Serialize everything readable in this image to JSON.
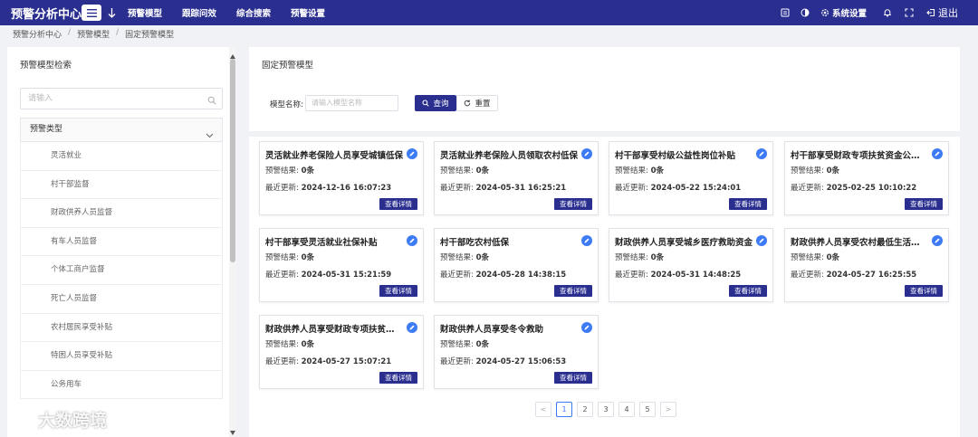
{
  "header": {
    "brand": "预警分析中心",
    "nav": [
      "预警模型",
      "跟踪问效",
      "综合搜索",
      "预警设置"
    ],
    "right": {
      "settings_label": "系统设置",
      "logout_label": "退出"
    }
  },
  "breadcrumb": [
    "预警分析中心",
    "预警模型",
    "固定预警模型"
  ],
  "left_panel": {
    "title": "预警模型检索",
    "search_placeholder": "请输入",
    "type_header": "预警类型",
    "types": [
      "灵活就业",
      "村干部监督",
      "财政供养人员监督",
      "有车人员监督",
      "个体工商户监督",
      "死亡人员监督",
      "农村居民享受补贴",
      "特困人员享受补贴",
      "公务用车"
    ]
  },
  "right_panel": {
    "title": "固定预警模型",
    "filter_label": "模型名称:",
    "filter_placeholder": "请输入模型名称",
    "query_label": "查询",
    "reset_label": "重置",
    "result_label": "预警结果:",
    "update_label": "最近更新:",
    "detail_label": "查看详情",
    "cards": [
      {
        "title": "灵活就业养老保险人员享受城镇低保",
        "result": "0条",
        "updated": "2024-12-16 16:07:23"
      },
      {
        "title": "灵活就业养老保险人员领取农村低保",
        "result": "0条",
        "updated": "2024-05-31 16:25:21"
      },
      {
        "title": "村干部享受村级公益性岗位补贴",
        "result": "0条",
        "updated": "2024-05-22 15:24:01"
      },
      {
        "title": "村干部享受财政专项扶贫资金公益性…",
        "result": "0条",
        "updated": "2025-02-25 10:10:22"
      },
      {
        "title": "村干部享受灵活就业社保补贴",
        "result": "0条",
        "updated": "2024-05-31 15:21:59"
      },
      {
        "title": "村干部吃农村低保",
        "result": "0条",
        "updated": "2024-05-28 14:38:15"
      },
      {
        "title": "财政供养人员享受城乡医疗救助资金",
        "result": "0条",
        "updated": "2024-05-31 14:48:25"
      },
      {
        "title": "财政供养人员享受农村最低生活保障…",
        "result": "0条",
        "updated": "2024-05-27 16:25:55"
      },
      {
        "title": "财政供养人员享受财政专项扶贫资金…",
        "result": "0条",
        "updated": "2024-05-27 15:07:21"
      },
      {
        "title": "财政供养人员享受冬令救助",
        "result": "0条",
        "updated": "2024-05-27 15:06:53"
      }
    ]
  },
  "pagination": {
    "prev": "<",
    "pages": [
      "1",
      "2",
      "3",
      "4",
      "5"
    ],
    "current": "1",
    "next": ">"
  },
  "watermark": "大数跨境",
  "colors": {
    "primary": "#2a2f8f",
    "accent": "#3d7bf5"
  }
}
